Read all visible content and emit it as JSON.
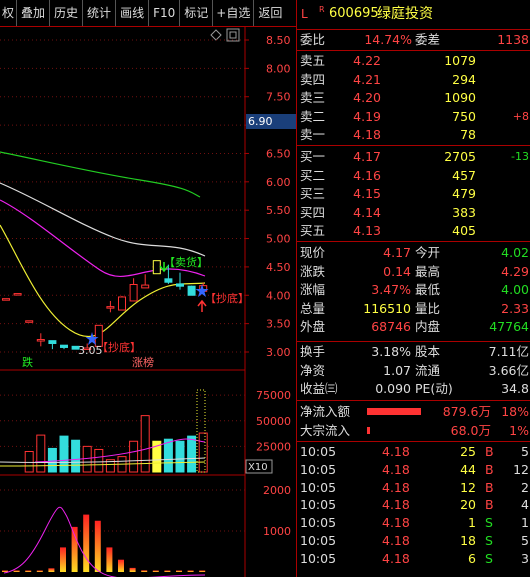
{
  "toolbar": {
    "items": [
      "权",
      "叠加",
      "历史",
      "统计",
      "画线",
      "F10",
      "标记",
      "+自选",
      "返回"
    ]
  },
  "price_axis": {
    "ticks": [
      "8.50",
      "8.00",
      "7.50",
      "7.00",
      "6.50",
      "6.00",
      "5.50",
      "5.00",
      "4.50",
      "4.00",
      "3.50",
      "3.00"
    ],
    "highlight": "6.90"
  },
  "chart_labels": {
    "sell": "【卖货】",
    "buy1": "【抄底】",
    "buy2": "【抄底】",
    "low": "3.05",
    "down": "跌",
    "up": "涨榜",
    "mult": "X10"
  },
  "vol_axis": {
    "ticks": [
      "75000",
      "50000",
      "25000"
    ]
  },
  "ind_axis": {
    "ticks": [
      "2000",
      "1000"
    ]
  },
  "chart_data": [
    {
      "type": "candlestick",
      "ylim": [
        3.0,
        8.5
      ],
      "y_ticks": [
        8.5,
        8.0,
        7.5,
        7.0,
        6.5,
        6.0,
        5.5,
        5.0,
        4.5,
        4.0,
        3.5,
        3.0
      ],
      "annotations": [
        "【卖货】",
        "【抄底】",
        "【抄底】",
        "3.05",
        "跌",
        "涨榜"
      ],
      "candles": [
        {
          "o": 3.94,
          "c": 3.94,
          "h": 3.94,
          "l": 3.94
        },
        {
          "o": 4.03,
          "c": 4.03,
          "h": 4.03,
          "l": 4.03
        },
        {
          "o": 3.55,
          "c": 3.55,
          "h": 3.55,
          "l": 3.55
        },
        {
          "o": 3.22,
          "c": 3.22,
          "h": 3.33,
          "l": 3.1
        },
        {
          "o": 3.2,
          "c": 3.15,
          "h": 3.2,
          "l": 3.05
        },
        {
          "o": 3.12,
          "c": 3.08,
          "h": 3.12,
          "l": 3.05
        },
        {
          "o": 3.1,
          "c": 3.05,
          "h": 3.1,
          "l": 3.05
        },
        {
          "o": 3.05,
          "c": 3.07,
          "h": 3.15,
          "l": 3.05
        },
        {
          "o": 3.1,
          "c": 3.47,
          "h": 3.47,
          "l": 3.1
        },
        {
          "o": 3.8,
          "c": 3.8,
          "h": 3.9,
          "l": 3.7
        },
        {
          "o": 3.74,
          "c": 3.97,
          "h": 3.99,
          "l": 3.74
        },
        {
          "o": 3.9,
          "c": 4.19,
          "h": 4.3,
          "l": 3.9
        },
        {
          "o": 4.13,
          "c": 4.18,
          "h": 4.37,
          "l": 4.13
        },
        {
          "o": 4.38,
          "c": 4.61,
          "h": 4.61,
          "l": 4.38
        },
        {
          "o": 4.29,
          "c": 4.23,
          "h": 4.54,
          "l": 4.2
        },
        {
          "o": 4.2,
          "c": 4.16,
          "h": 4.4,
          "l": 4.1
        },
        {
          "o": 4.16,
          "c": 4.0,
          "h": 4.17,
          "l": 4.0
        },
        {
          "o": 4.07,
          "c": 4.17,
          "h": 4.22,
          "l": 4.04
        }
      ]
    },
    {
      "type": "bar",
      "title": "volume",
      "y_ticks": [
        75000,
        50000,
        25000
      ],
      "values": [
        0,
        0,
        20000,
        36000,
        23000,
        35000,
        31000,
        25000,
        22000,
        12000,
        15000,
        30000,
        55000,
        30000,
        32000,
        30000,
        35000,
        38000
      ]
    },
    {
      "type": "bar",
      "title": "indicator",
      "y_ticks": [
        2000,
        1000
      ],
      "values": [
        0,
        0,
        10,
        10,
        90,
        600,
        1100,
        1400,
        1250,
        600,
        300,
        100,
        40,
        10,
        0,
        0,
        0,
        0
      ]
    }
  ],
  "quote": {
    "flag": "L",
    "flag2": "R",
    "code": "600695",
    "name": "绿庭投资",
    "wb_label": "委比",
    "wb_val": "14.74%",
    "wc_label": "委差",
    "wc_val": "1138",
    "asks": [
      {
        "label": "卖五",
        "price": "4.22",
        "vol": "1079",
        "chg": ""
      },
      {
        "label": "卖四",
        "price": "4.21",
        "vol": "294",
        "chg": ""
      },
      {
        "label": "卖三",
        "price": "4.20",
        "vol": "1090",
        "chg": ""
      },
      {
        "label": "卖二",
        "price": "4.19",
        "vol": "750",
        "chg": "+8"
      },
      {
        "label": "卖一",
        "price": "4.18",
        "vol": "78",
        "chg": ""
      }
    ],
    "bids": [
      {
        "label": "买一",
        "price": "4.17",
        "vol": "2705",
        "chg": "-13"
      },
      {
        "label": "买二",
        "price": "4.16",
        "vol": "457",
        "chg": ""
      },
      {
        "label": "买三",
        "price": "4.15",
        "vol": "479",
        "chg": ""
      },
      {
        "label": "买四",
        "price": "4.14",
        "vol": "383",
        "chg": ""
      },
      {
        "label": "买五",
        "price": "4.13",
        "vol": "405",
        "chg": ""
      }
    ],
    "stats": [
      {
        "l1": "现价",
        "v1": "4.17",
        "c1": "red",
        "l2": "今开",
        "v2": "4.02",
        "c2": "grn"
      },
      {
        "l1": "涨跌",
        "v1": "0.14",
        "c1": "red",
        "l2": "最高",
        "v2": "4.29",
        "c2": "red"
      },
      {
        "l1": "涨幅",
        "v1": "3.47%",
        "c1": "red",
        "l2": "最低",
        "v2": "4.00",
        "c2": "grn"
      },
      {
        "l1": "总量",
        "v1": "116510",
        "c1": "yel",
        "l2": "量比",
        "v2": "2.33",
        "c2": "red"
      },
      {
        "l1": "外盘",
        "v1": "68746",
        "c1": "red",
        "l2": "内盘",
        "v2": "47764",
        "c2": "grn"
      }
    ],
    "stats2": [
      {
        "l1": "换手",
        "v1": "3.18%",
        "l2": "股本",
        "v2": "7.11亿"
      },
      {
        "l1": "净资",
        "v1": "1.07",
        "l2": "流通",
        "v2": "3.66亿"
      },
      {
        "l1": "收益㈢",
        "v1": "0.090",
        "l2": "PE(动)",
        "v2": "34.8"
      }
    ],
    "flows": [
      {
        "label": "净流入额",
        "val": "879.6万",
        "pct": "18%",
        "fill": 0.6
      },
      {
        "label": "大宗流入",
        "val": "68.0万",
        "pct": "1%",
        "fill": 0.03
      }
    ],
    "ticks": [
      {
        "time": "10:05",
        "price": "4.18",
        "vol": "25",
        "dir": "B",
        "n": "5"
      },
      {
        "time": "10:05",
        "price": "4.18",
        "vol": "44",
        "dir": "B",
        "n": "12"
      },
      {
        "time": "10:05",
        "price": "4.18",
        "vol": "12",
        "dir": "B",
        "n": "2"
      },
      {
        "time": "10:05",
        "price": "4.18",
        "vol": "20",
        "dir": "B",
        "n": "4"
      },
      {
        "time": "10:05",
        "price": "4.18",
        "vol": "1",
        "dir": "S",
        "n": "1"
      },
      {
        "time": "10:05",
        "price": "4.18",
        "vol": "18",
        "dir": "S",
        "n": "5"
      },
      {
        "time": "10:05",
        "price": "4.18",
        "vol": "6",
        "dir": "S",
        "n": "3"
      }
    ]
  }
}
